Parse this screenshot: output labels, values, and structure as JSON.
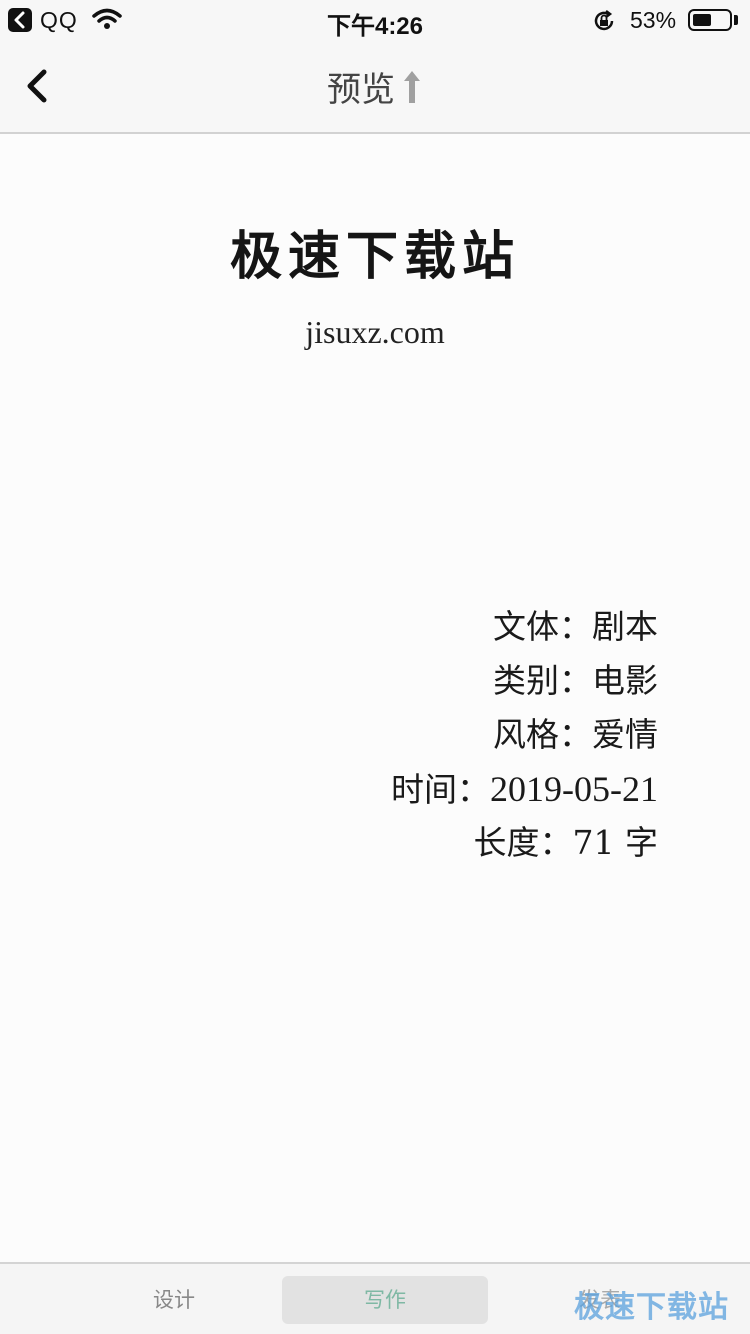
{
  "status_bar": {
    "back_app": "QQ",
    "time": "下午4:26",
    "battery_percent_label": "53%",
    "battery_level": 0.53
  },
  "nav": {
    "title": "预览"
  },
  "document": {
    "title": "极速下载站",
    "subtitle": "jisuxz.com",
    "meta": [
      {
        "label": "文体：",
        "value": "剧本"
      },
      {
        "label": "类别：",
        "value": "电影"
      },
      {
        "label": "风格：",
        "value": "爱情"
      },
      {
        "label": "时间：",
        "value": "2019-05-21"
      },
      {
        "label": "长度：",
        "value": "71 字"
      }
    ]
  },
  "tabs": [
    {
      "label": "设计"
    },
    {
      "label": "写作"
    },
    {
      "label": "发表"
    }
  ],
  "watermark": "极速下载站",
  "colors": {
    "active_tab_text": "#7fb8a4",
    "watermark": "#5aa0dc"
  }
}
